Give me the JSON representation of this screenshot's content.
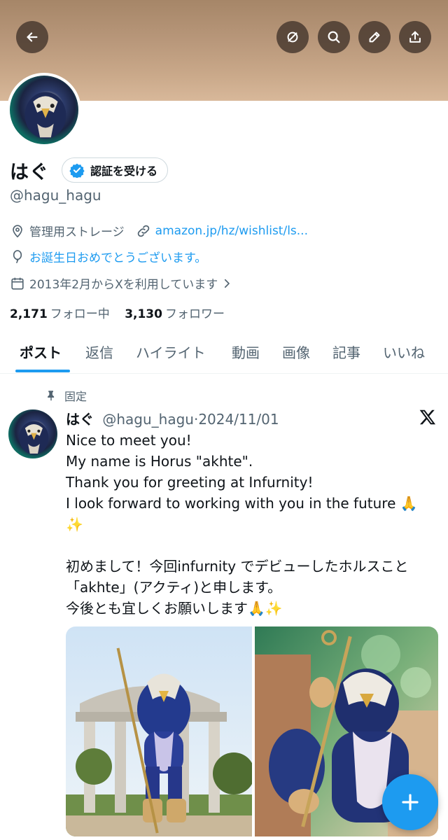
{
  "profile": {
    "name": "はぐ",
    "verify_label": "認証を受ける",
    "handle": "@hagu_hagu",
    "location": "管理用ストレージ",
    "link": "amazon.jp/hz/wishlist/ls...",
    "birthday": "お誕生日おめでとうございます。",
    "joined": "2013年2月からXを利用しています",
    "following_count": "2,171",
    "following_label": "フォロー中",
    "followers_count": "3,130",
    "followers_label": "フォロワー"
  },
  "tabs": [
    {
      "label": "ポスト",
      "active": true
    },
    {
      "label": "返信"
    },
    {
      "label": "ハイライト"
    },
    {
      "label": "動画"
    },
    {
      "label": "画像"
    },
    {
      "label": "記事"
    },
    {
      "label": "いいね"
    }
  ],
  "post": {
    "pinned_label": "固定",
    "author_name": "はぐ",
    "author_handle": "@hagu_hagu",
    "separator": "·",
    "date": "2024/11/01",
    "lines": [
      "Nice to meet you!",
      "My name is Horus \"akhte\".",
      "Thank you for greeting at Infurnity!",
      "I look forward to working with you in the future 🙏",
      "✨",
      "",
      "初めまして！今回infurnity でデビューしたホルスこと",
      "「akhte」(アクティ)と申します。",
      "今後とも宜しくお願いします🙏✨"
    ]
  },
  "icons": {
    "back": "arrow-left-icon",
    "topbar": [
      "grok-icon",
      "search-icon",
      "edit-icon",
      "share-icon"
    ],
    "verified": "verified-badge-icon",
    "location": "location-pin-icon",
    "link": "link-icon",
    "birthday": "balloon-icon",
    "calendar": "calendar-icon",
    "chevron": "chevron-right-icon",
    "pin": "pin-icon",
    "x_logo": "x-logo-icon",
    "fab": "plus-icon"
  },
  "colors": {
    "accent": "#1d9bf0",
    "text": "#0f1419",
    "muted": "#536471"
  }
}
